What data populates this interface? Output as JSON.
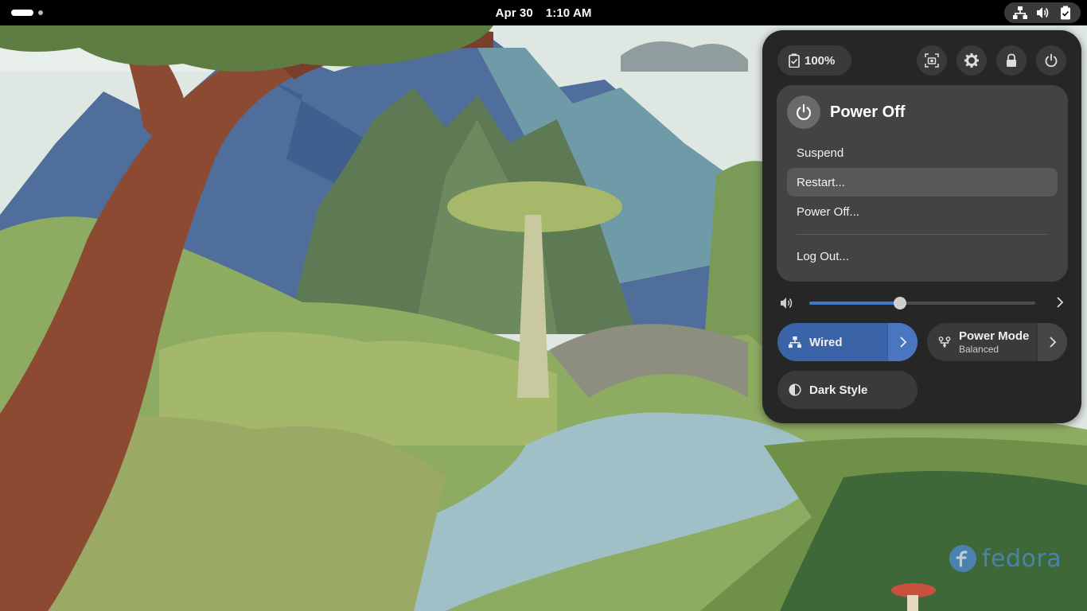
{
  "topbar": {
    "date": "Apr 30",
    "time": "1:10 AM"
  },
  "quick_settings": {
    "battery_label": "100%",
    "header_icons": [
      "screenshot-icon",
      "gear-icon",
      "lock-icon",
      "power-icon"
    ],
    "power_menu": {
      "title": "Power Off",
      "items": [
        {
          "label": "Suspend"
        },
        {
          "label": "Restart..."
        },
        {
          "label": "Power Off..."
        },
        {
          "label": "Log Out..."
        }
      ],
      "hovered_index": 1
    },
    "volume": {
      "level_percent": 40
    },
    "toggles": {
      "wired": {
        "label": "Wired",
        "active": true
      },
      "power_mode": {
        "label": "Power Mode",
        "sublabel": "Balanced",
        "active": false
      },
      "dark_style": {
        "label": "Dark Style",
        "active": false
      }
    }
  },
  "wallpaper": {
    "logo_text": "fedora"
  },
  "colors": {
    "accent": "#3b63a8",
    "panel_bg": "#262626",
    "menu_bg": "#434343"
  }
}
